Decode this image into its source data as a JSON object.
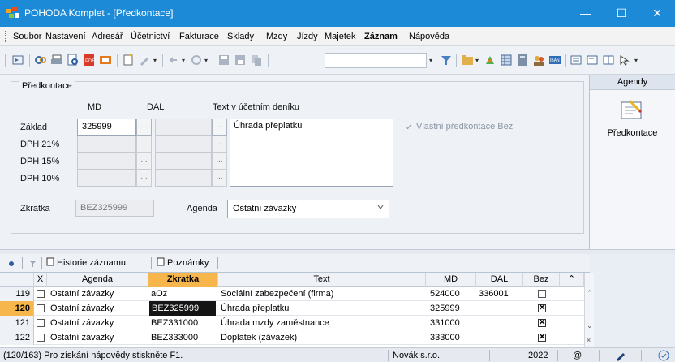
{
  "window": {
    "title": "POHODA Komplet - [Předkontace]"
  },
  "menu": [
    "Soubor",
    "Nastavení",
    "Adresář",
    "Účetnictví",
    "Fakturace",
    "Sklady",
    "Mzdy",
    "Jízdy",
    "Majetek",
    "Záznam",
    "Nápověda"
  ],
  "form": {
    "group_title": "Předkontace",
    "col_md": "MD",
    "col_dal": "DAL",
    "col_text": "Text v účetním deníku",
    "rows": [
      {
        "label": "Základ",
        "md": "325999"
      },
      {
        "label": "DPH 21%",
        "md": ""
      },
      {
        "label": "DPH 15%",
        "md": ""
      },
      {
        "label": "DPH 10%",
        "md": ""
      }
    ],
    "dots": "...",
    "text_value": "Úhrada přeplatku",
    "check_label": "Vlastní předkontace Bez",
    "zkratka_label": "Zkratka",
    "zkratka_value": "BEZ325999",
    "agenda_label": "Agenda",
    "agenda_value": "Ostatní závazky"
  },
  "agendy_panel": {
    "header": "Agendy",
    "item": "Předkontace"
  },
  "tabs": [
    {
      "label": "Historie záznamu"
    },
    {
      "label": "Poznámky"
    }
  ],
  "grid": {
    "headers": {
      "x": "X",
      "agenda": "Agenda",
      "zkratka": "Zkratka",
      "text": "Text",
      "md": "MD",
      "dal": "DAL",
      "bez": "Bez"
    },
    "rows": [
      {
        "num": "119",
        "agenda": "Ostatní závazky",
        "zkratka": "aOz",
        "text": "Sociální zabezpečení (firma)",
        "md": "524000",
        "dal": "336001",
        "bez": false
      },
      {
        "num": "120",
        "agenda": "Ostatní závazky",
        "zkratka": "BEZ325999",
        "text": "Úhrada přeplatku",
        "md": "325999",
        "dal": "",
        "bez": true
      },
      {
        "num": "121",
        "agenda": "Ostatní závazky",
        "zkratka": "BEZ331000",
        "text": "Úhrada mzdy zaměstnance",
        "md": "331000",
        "dal": "",
        "bez": true
      },
      {
        "num": "122",
        "agenda": "Ostatní závazky",
        "zkratka": "BEZ333000",
        "text": "Doplatek (závazek)",
        "md": "333000",
        "dal": "",
        "bez": true
      }
    ],
    "active_row": 1
  },
  "status": {
    "hint": "(120/163) Pro získání nápovědy stiskněte F1.",
    "company": "Novák s.r.o.",
    "year": "2022",
    "at": "@"
  },
  "colors": {
    "title_bar": "#1c8ad6",
    "highlight": "#f7b64c"
  }
}
